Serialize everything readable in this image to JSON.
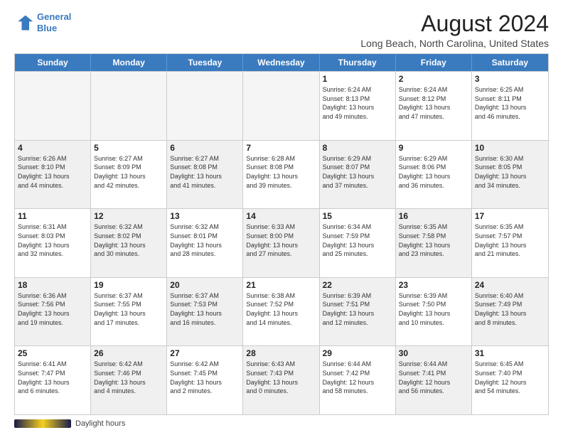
{
  "header": {
    "logo_line1": "General",
    "logo_line2": "Blue",
    "main_title": "August 2024",
    "subtitle": "Long Beach, North Carolina, United States"
  },
  "days_of_week": [
    "Sunday",
    "Monday",
    "Tuesday",
    "Wednesday",
    "Thursday",
    "Friday",
    "Saturday"
  ],
  "footer": {
    "daylight_label": "Daylight hours"
  },
  "weeks": [
    [
      {
        "day": "",
        "info": "",
        "empty": true
      },
      {
        "day": "",
        "info": "",
        "empty": true
      },
      {
        "day": "",
        "info": "",
        "empty": true
      },
      {
        "day": "",
        "info": "",
        "empty": true
      },
      {
        "day": "1",
        "info": "Sunrise: 6:24 AM\nSunset: 8:13 PM\nDaylight: 13 hours\nand 49 minutes."
      },
      {
        "day": "2",
        "info": "Sunrise: 6:24 AM\nSunset: 8:12 PM\nDaylight: 13 hours\nand 47 minutes."
      },
      {
        "day": "3",
        "info": "Sunrise: 6:25 AM\nSunset: 8:11 PM\nDaylight: 13 hours\nand 46 minutes."
      }
    ],
    [
      {
        "day": "4",
        "info": "Sunrise: 6:26 AM\nSunset: 8:10 PM\nDaylight: 13 hours\nand 44 minutes.",
        "shaded": true
      },
      {
        "day": "5",
        "info": "Sunrise: 6:27 AM\nSunset: 8:09 PM\nDaylight: 13 hours\nand 42 minutes."
      },
      {
        "day": "6",
        "info": "Sunrise: 6:27 AM\nSunset: 8:08 PM\nDaylight: 13 hours\nand 41 minutes.",
        "shaded": true
      },
      {
        "day": "7",
        "info": "Sunrise: 6:28 AM\nSunset: 8:08 PM\nDaylight: 13 hours\nand 39 minutes."
      },
      {
        "day": "8",
        "info": "Sunrise: 6:29 AM\nSunset: 8:07 PM\nDaylight: 13 hours\nand 37 minutes.",
        "shaded": true
      },
      {
        "day": "9",
        "info": "Sunrise: 6:29 AM\nSunset: 8:06 PM\nDaylight: 13 hours\nand 36 minutes."
      },
      {
        "day": "10",
        "info": "Sunrise: 6:30 AM\nSunset: 8:05 PM\nDaylight: 13 hours\nand 34 minutes.",
        "shaded": true
      }
    ],
    [
      {
        "day": "11",
        "info": "Sunrise: 6:31 AM\nSunset: 8:03 PM\nDaylight: 13 hours\nand 32 minutes."
      },
      {
        "day": "12",
        "info": "Sunrise: 6:32 AM\nSunset: 8:02 PM\nDaylight: 13 hours\nand 30 minutes.",
        "shaded": true
      },
      {
        "day": "13",
        "info": "Sunrise: 6:32 AM\nSunset: 8:01 PM\nDaylight: 13 hours\nand 28 minutes."
      },
      {
        "day": "14",
        "info": "Sunrise: 6:33 AM\nSunset: 8:00 PM\nDaylight: 13 hours\nand 27 minutes.",
        "shaded": true
      },
      {
        "day": "15",
        "info": "Sunrise: 6:34 AM\nSunset: 7:59 PM\nDaylight: 13 hours\nand 25 minutes."
      },
      {
        "day": "16",
        "info": "Sunrise: 6:35 AM\nSunset: 7:58 PM\nDaylight: 13 hours\nand 23 minutes.",
        "shaded": true
      },
      {
        "day": "17",
        "info": "Sunrise: 6:35 AM\nSunset: 7:57 PM\nDaylight: 13 hours\nand 21 minutes."
      }
    ],
    [
      {
        "day": "18",
        "info": "Sunrise: 6:36 AM\nSunset: 7:56 PM\nDaylight: 13 hours\nand 19 minutes.",
        "shaded": true
      },
      {
        "day": "19",
        "info": "Sunrise: 6:37 AM\nSunset: 7:55 PM\nDaylight: 13 hours\nand 17 minutes."
      },
      {
        "day": "20",
        "info": "Sunrise: 6:37 AM\nSunset: 7:53 PM\nDaylight: 13 hours\nand 16 minutes.",
        "shaded": true
      },
      {
        "day": "21",
        "info": "Sunrise: 6:38 AM\nSunset: 7:52 PM\nDaylight: 13 hours\nand 14 minutes."
      },
      {
        "day": "22",
        "info": "Sunrise: 6:39 AM\nSunset: 7:51 PM\nDaylight: 13 hours\nand 12 minutes.",
        "shaded": true
      },
      {
        "day": "23",
        "info": "Sunrise: 6:39 AM\nSunset: 7:50 PM\nDaylight: 13 hours\nand 10 minutes."
      },
      {
        "day": "24",
        "info": "Sunrise: 6:40 AM\nSunset: 7:49 PM\nDaylight: 13 hours\nand 8 minutes.",
        "shaded": true
      }
    ],
    [
      {
        "day": "25",
        "info": "Sunrise: 6:41 AM\nSunset: 7:47 PM\nDaylight: 13 hours\nand 6 minutes."
      },
      {
        "day": "26",
        "info": "Sunrise: 6:42 AM\nSunset: 7:46 PM\nDaylight: 13 hours\nand 4 minutes.",
        "shaded": true
      },
      {
        "day": "27",
        "info": "Sunrise: 6:42 AM\nSunset: 7:45 PM\nDaylight: 13 hours\nand 2 minutes."
      },
      {
        "day": "28",
        "info": "Sunrise: 6:43 AM\nSunset: 7:43 PM\nDaylight: 13 hours\nand 0 minutes.",
        "shaded": true
      },
      {
        "day": "29",
        "info": "Sunrise: 6:44 AM\nSunset: 7:42 PM\nDaylight: 12 hours\nand 58 minutes."
      },
      {
        "day": "30",
        "info": "Sunrise: 6:44 AM\nSunset: 7:41 PM\nDaylight: 12 hours\nand 56 minutes.",
        "shaded": true
      },
      {
        "day": "31",
        "info": "Sunrise: 6:45 AM\nSunset: 7:40 PM\nDaylight: 12 hours\nand 54 minutes."
      }
    ]
  ]
}
